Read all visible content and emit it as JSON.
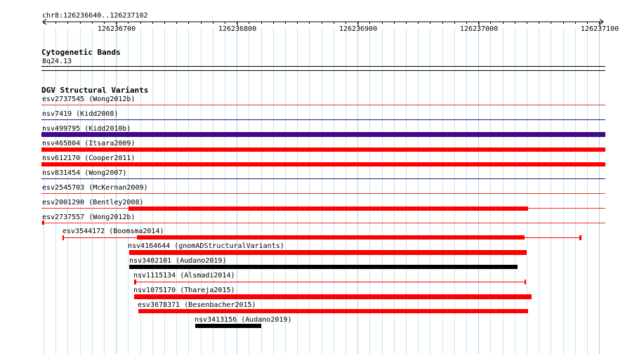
{
  "ruler": {
    "range_label": "chr8:126236640..126237102",
    "ticks": [
      "126236700",
      "126236800",
      "126236900",
      "126237000",
      "126237100"
    ]
  },
  "cytoband": {
    "title": "Cytogenetic Bands",
    "band": "8q24.13"
  },
  "dgv": {
    "title": "DGV Structural Variants",
    "colors": {
      "red": "#ff0000",
      "purple": "#3f0a8c",
      "black": "#000000",
      "gridline": "#c8e6f0",
      "navy_line": "#1c1c8c"
    },
    "tracks": [
      {
        "label": "esv2737545 (Wong2012b)",
        "color": "red",
        "style": "thin"
      },
      {
        "label": "nsv7419 (Kidd2008)",
        "color": "navy_line",
        "style": "thin"
      },
      {
        "label": "nsv499795 (Kidd2010b)",
        "color": "purple",
        "style": "thick"
      },
      {
        "label": "nsv465804 (Itsara2009)",
        "color": "red",
        "style": "thick"
      },
      {
        "label": "nsv612170 (Cooper2011)",
        "color": "red",
        "style": "thick"
      },
      {
        "label": "nsv831454 (Wong2007)",
        "color": "navy_line",
        "style": "thin"
      },
      {
        "label": "esv2545703 (McKernan2009)",
        "color": "red",
        "style": "thin"
      },
      {
        "label": "esv2001290 (Bentley2008)",
        "color": "red",
        "style": "thin"
      },
      {
        "label": "esv2737557 (Wong2012b)",
        "color": "red",
        "style": "thin"
      }
    ],
    "features": [
      {
        "label": "esv3544172 (Boomsma2014)"
      },
      {
        "label": "nsv4164644 (gnomADStructuralVariants)"
      },
      {
        "label": "nsv3402101 (Audano2019)"
      },
      {
        "label": "nsv1115134 (Alsmadi2014)"
      },
      {
        "label": "nsv1075170 (Thareja2015)"
      },
      {
        "label": "esv3678371 (Besenbacher2015)"
      },
      {
        "label": "nsv3413156 (Audano2019)"
      }
    ]
  }
}
